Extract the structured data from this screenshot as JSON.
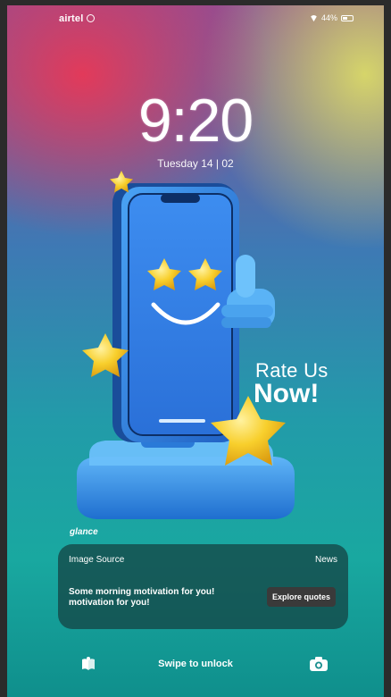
{
  "status_bar": {
    "carrier": "airtel",
    "battery_text": "44%"
  },
  "lock_screen": {
    "time": "9:20",
    "date": "Tuesday 14 | 02"
  },
  "promo": {
    "line1": "Rate Us",
    "line2": "Now!"
  },
  "notification": {
    "brand": "glance",
    "source": "Image Source",
    "tag": "News",
    "message": "Some morning motivation for you! motivation for you!",
    "action_label": "Explore quotes"
  },
  "bottom_bar": {
    "swipe_text": "Swipe to unlock",
    "left_icon": "book-icon",
    "right_icon": "camera-icon"
  },
  "colors": {
    "accent_star": "#f6c21c",
    "phone_blue": "#2f84e8",
    "notif_bg": "#144646"
  }
}
